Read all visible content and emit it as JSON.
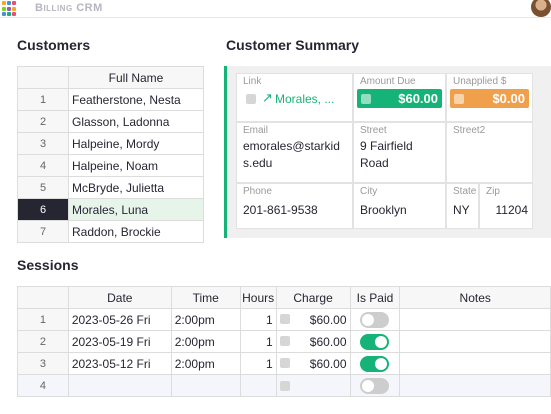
{
  "app": {
    "title": "Billing CRM",
    "logo_icon": "grid-logo-icon",
    "avatar": "user-avatar"
  },
  "colors": {
    "accent": "#16b378",
    "warning": "#f0a04b",
    "selected_row": "#e6f4ea"
  },
  "customers": {
    "title": "Customers",
    "column_header": "Full Name",
    "rows": [
      {
        "num": "1",
        "name": "Featherstone, Nesta"
      },
      {
        "num": "2",
        "name": "Glasson, Ladonna"
      },
      {
        "num": "3",
        "name": "Halpeine, Mordy"
      },
      {
        "num": "4",
        "name": "Halpeine, Noam"
      },
      {
        "num": "5",
        "name": "McBryde, Julietta"
      },
      {
        "num": "6",
        "name": "Morales, Luna"
      },
      {
        "num": "7",
        "name": "Raddon, Brockie"
      }
    ],
    "selected_row": 6
  },
  "summary": {
    "title": "Customer Summary",
    "link_label": "Link",
    "link_value": "Morales, ...",
    "amount_due_label": "Amount Due",
    "amount_due_value": "$60.00",
    "unapplied_label": "Unapplied $",
    "unapplied_value": "$0.00",
    "email_label": "Email",
    "email_line1": "emorales@starkid",
    "email_line2": "s.edu",
    "street_label": "Street",
    "street_line1": "9 Fairfield",
    "street_line2": "Road",
    "street2_label": "Street2",
    "street2_value": "",
    "phone_label": "Phone",
    "phone_value": "201-861-9538",
    "city_label": "City",
    "city_value": "Brooklyn",
    "state_label": "State",
    "state_value": "NY",
    "zip_label": "Zip",
    "zip_value": "11204"
  },
  "sessions": {
    "title": "Sessions",
    "headers": {
      "date": "Date",
      "time": "Time",
      "hours": "Hours",
      "charge": "Charge",
      "is_paid": "Is Paid",
      "notes": "Notes"
    },
    "rows": [
      {
        "num": "1",
        "date": "2023-05-26 Fri",
        "time": "2:00pm",
        "hours": "1",
        "charge": "$60.00",
        "paid": false,
        "notes": ""
      },
      {
        "num": "2",
        "date": "2023-05-19 Fri",
        "time": "2:00pm",
        "hours": "1",
        "charge": "$60.00",
        "paid": true,
        "notes": ""
      },
      {
        "num": "3",
        "date": "2023-05-12 Fri",
        "time": "2:00pm",
        "hours": "1",
        "charge": "$60.00",
        "paid": true,
        "notes": ""
      },
      {
        "num": "4",
        "date": "",
        "time": "",
        "hours": "",
        "charge": "",
        "paid": false,
        "notes": ""
      }
    ]
  }
}
